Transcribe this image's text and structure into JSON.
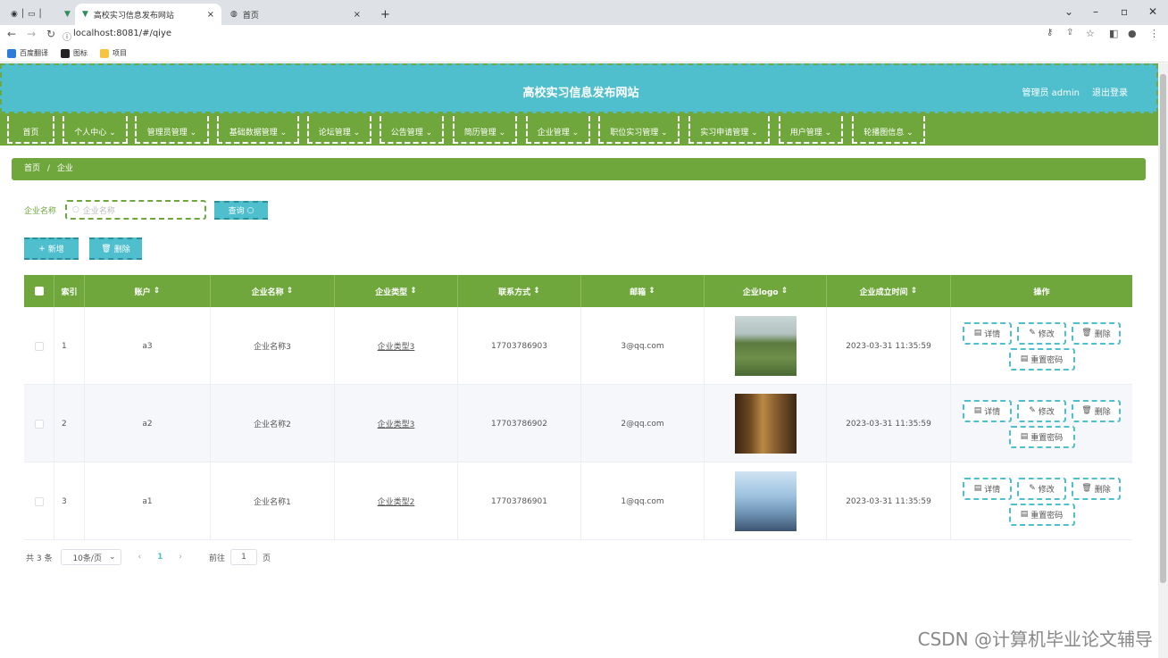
{
  "browser": {
    "tabs": [
      {
        "title": "高校实习信息发布网站"
      },
      {
        "title": "首页"
      }
    ],
    "new_tab": "+",
    "close": "×",
    "url": "localhost:8081/#/qiye",
    "bookmarks": [
      "百度翻译",
      "图标",
      "项目"
    ]
  },
  "header": {
    "title": "高校实习信息发布网站",
    "user": "管理员 admin",
    "logout": "退出登录"
  },
  "menu": [
    "首页",
    "个人中心",
    "管理员管理",
    "基础数据管理",
    "论坛管理",
    "公告管理",
    "简历管理",
    "企业管理",
    "职位实习管理",
    "实习申请管理",
    "用户管理",
    "轮播图信息"
  ],
  "breadcrumb": {
    "home": "首页",
    "sep": "/",
    "current": "企业"
  },
  "search": {
    "label": "企业名称",
    "placeholder": "企业名称",
    "button": "查询"
  },
  "actions": {
    "add": "新增",
    "delete": "删除"
  },
  "table": {
    "columns": [
      "",
      "索引",
      "账户",
      "企业名称",
      "企业类型",
      "联系方式",
      "邮箱",
      "企业logo",
      "企业成立时间",
      "操作"
    ],
    "rows": [
      {
        "index": "1",
        "account": "a3",
        "name": "企业名称3",
        "type": "企业类型3",
        "phone": "17703786903",
        "email": "3@qq.com",
        "time": "2023-03-31 11:35:59"
      },
      {
        "index": "2",
        "account": "a2",
        "name": "企业名称2",
        "type": "企业类型3",
        "phone": "17703786902",
        "email": "2@qq.com",
        "time": "2023-03-31 11:35:59"
      },
      {
        "index": "3",
        "account": "a1",
        "name": "企业名称1",
        "type": "企业类型2",
        "phone": "17703786901",
        "email": "1@qq.com",
        "time": "2023-03-31 11:35:59"
      }
    ],
    "row_ops": {
      "detail": "详情",
      "edit": "修改",
      "delete": "删除",
      "reset": "重置密码"
    }
  },
  "pagination": {
    "total": "共 3 条",
    "page_size": "10条/页",
    "current": "1",
    "goto_label": "前往",
    "goto_value": "1",
    "page_unit": "页"
  },
  "watermark": "CSDN @计算机毕业论文辅导",
  "colors": {
    "teal": "#4fbfcd",
    "green": "#6fa73c"
  }
}
